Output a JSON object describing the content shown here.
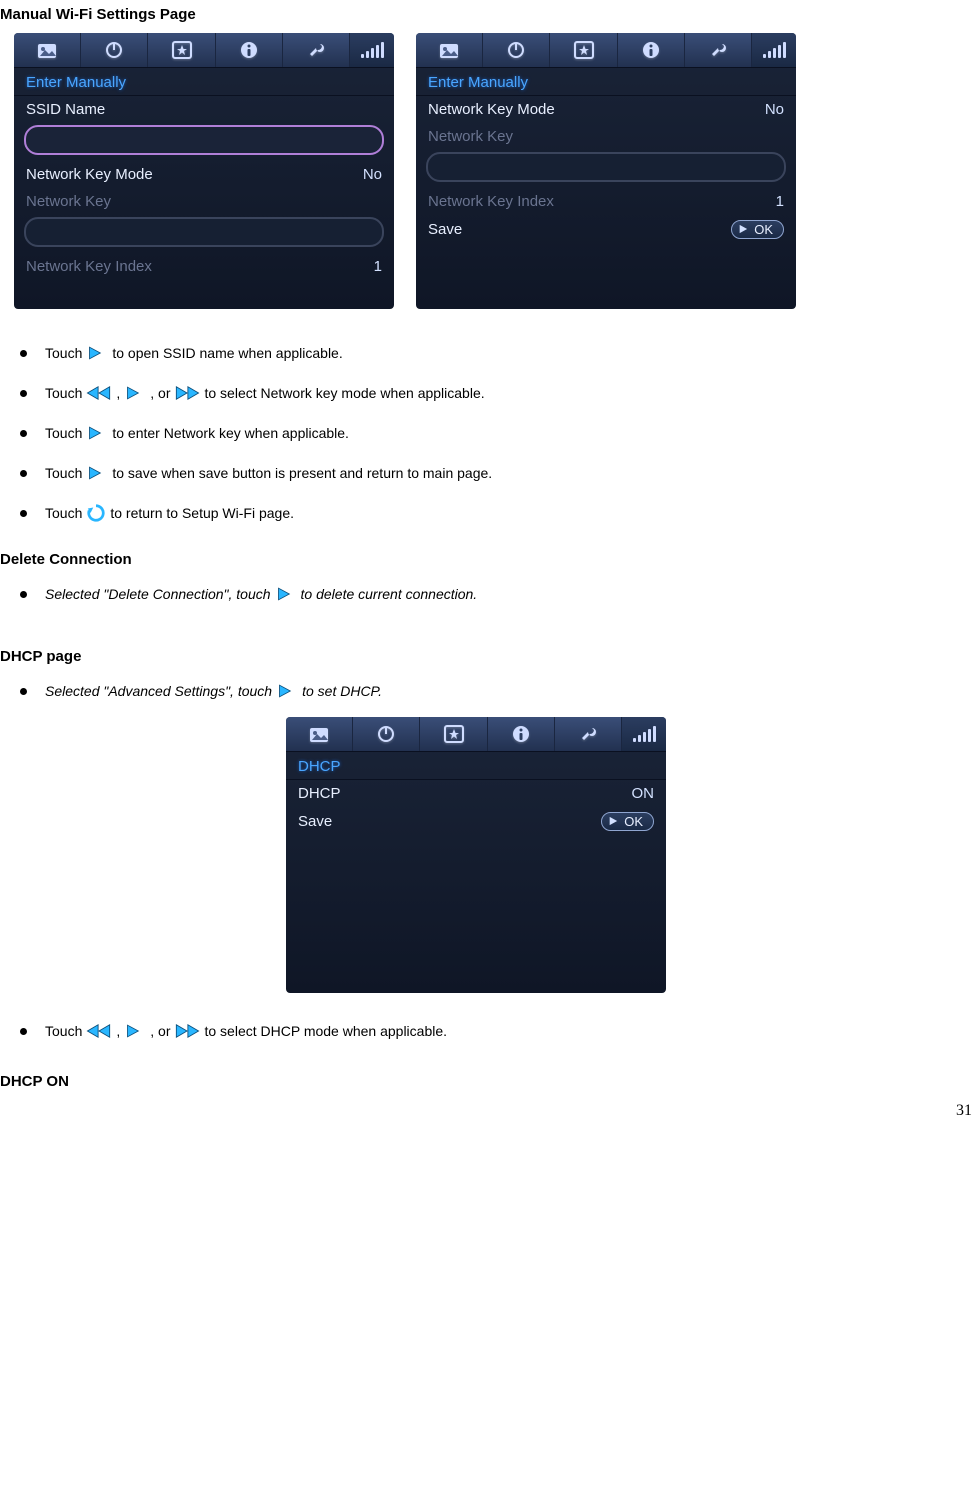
{
  "headings": {
    "manual_wifi": "Manual Wi-Fi Settings Page",
    "delete_connection": "Delete Connection",
    "dhcp_page": "DHCP page",
    "dhcp_on": "DHCP ON"
  },
  "bullets": {
    "b1_pre": "Touch",
    "b1_post": " to open SSID name when applicable.",
    "b2_pre": "Touch",
    "b2_sep1": ",",
    "b2_sep2": ", or",
    "b2_post": " to select Network key mode when applicable.",
    "b3_pre": "Touch",
    "b3_post": " to enter Network key when applicable.",
    "b4_pre": "Touch",
    "b4_post": " to save when save button is present and return to main page.",
    "b5_pre": "Touch",
    "b5_post": " to return to Setup Wi-Fi page.",
    "b6_pre": "Selected \"Delete Connection\", touch",
    "b6_post": " to delete current connection.",
    "b7_pre": "Selected \"Advanced Settings\", touch",
    "b7_post": " to set DHCP.",
    "b8_pre": "Touch",
    "b8_sep1": ",",
    "b8_sep2": ", or",
    "b8_post": " to select DHCP mode when applicable."
  },
  "screen1": {
    "title": "Enter Manually",
    "ssid_label": "SSID Name",
    "key_mode_label": "Network Key Mode",
    "key_mode_value": "No",
    "key_label": "Network Key",
    "key_index_label": "Network Key Index",
    "key_index_value": "1"
  },
  "screen2": {
    "title": "Enter Manually",
    "key_mode_label": "Network Key Mode",
    "key_mode_value": "No",
    "key_label": "Network Key",
    "key_index_label": "Network Key Index",
    "key_index_value": "1",
    "save_label": "Save",
    "ok_label": "OK"
  },
  "screen3": {
    "title": "DHCP",
    "dhcp_label": "DHCP",
    "dhcp_value": "ON",
    "save_label": "Save",
    "ok_label": "OK"
  },
  "page_number": "31"
}
